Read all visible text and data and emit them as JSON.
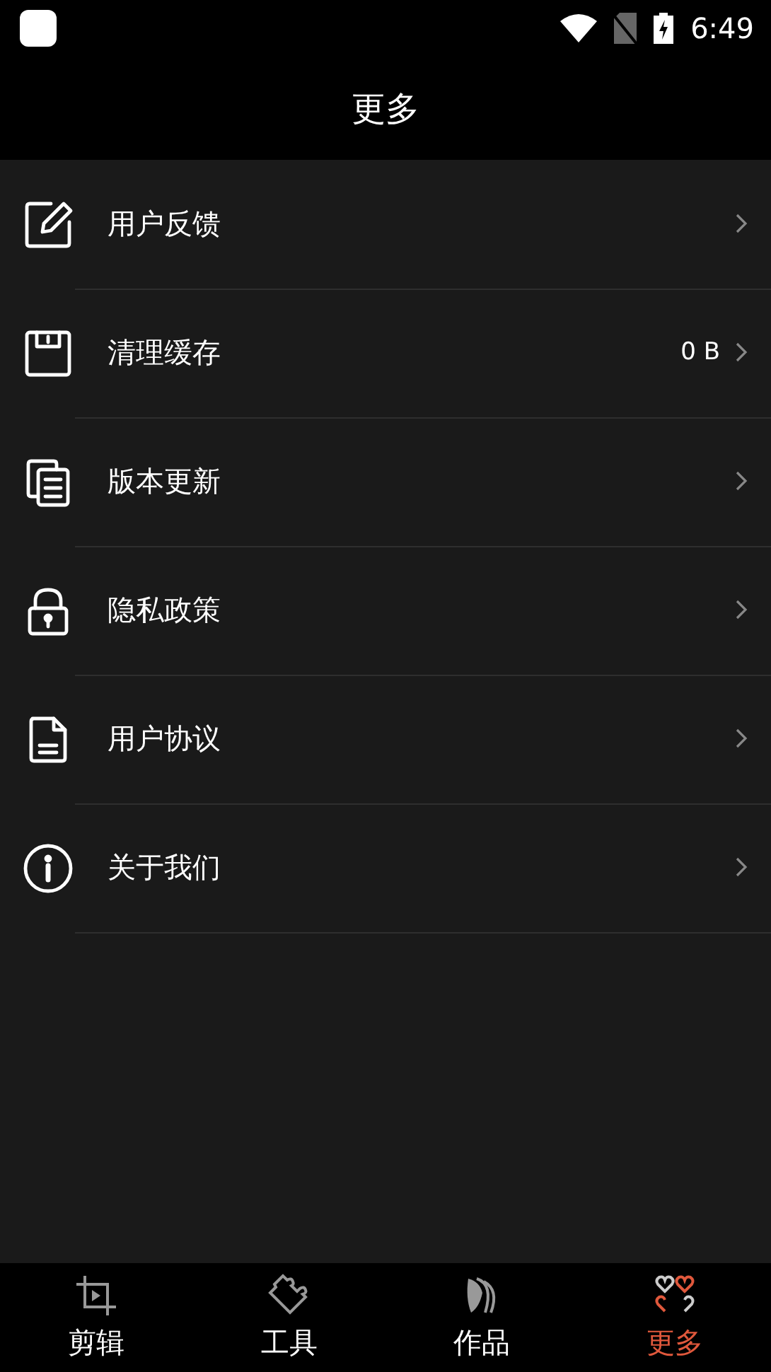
{
  "status_bar": {
    "time": "6:49"
  },
  "header": {
    "title": "更多"
  },
  "menu": [
    {
      "label": "用户反馈"
    },
    {
      "label": "清理缓存",
      "value": "0 B"
    },
    {
      "label": "版本更新"
    },
    {
      "label": "隐私政策"
    },
    {
      "label": "用户协议"
    },
    {
      "label": "关于我们"
    }
  ],
  "bottom_nav": [
    {
      "label": "剪辑",
      "selected": false
    },
    {
      "label": "工具",
      "selected": false
    },
    {
      "label": "作品",
      "selected": false
    },
    {
      "label": "更多",
      "selected": true
    }
  ]
}
